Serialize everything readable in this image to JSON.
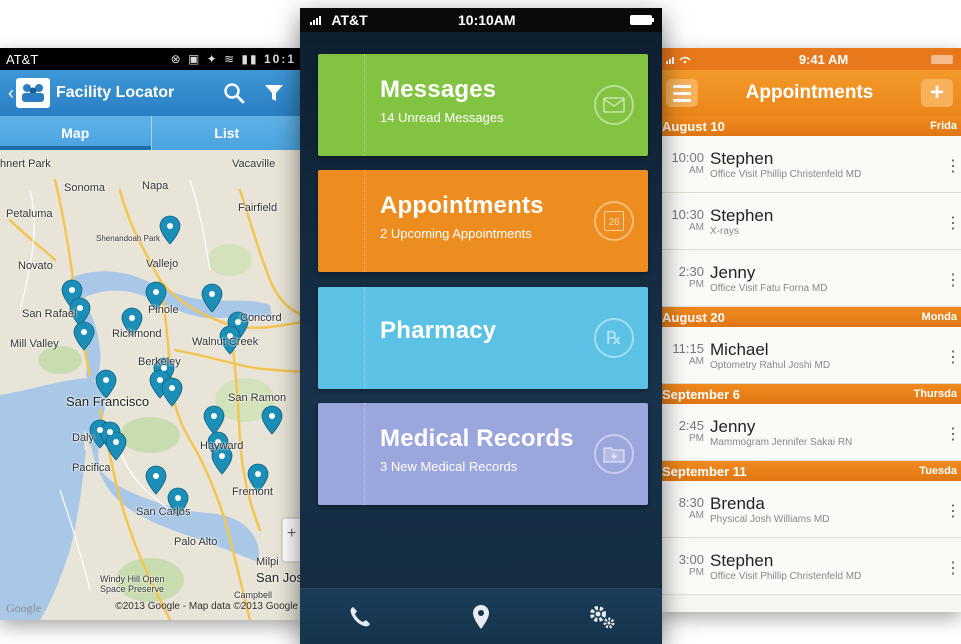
{
  "left_phone": {
    "status": {
      "carrier": "AT&T",
      "time": "10:1"
    },
    "app_bar": {
      "title": "Facility Locator"
    },
    "tabs": [
      {
        "label": "Map",
        "active": true
      },
      {
        "label": "List",
        "active": false
      }
    ],
    "map": {
      "places": [
        "hnert Park",
        "Sonoma",
        "Napa",
        "Vacaville",
        "Petaluma",
        "Fairfield",
        "Shenandoah Park",
        "Novato",
        "Vallejo",
        "San Rafael",
        "Pinole",
        "Concord",
        "Richmond",
        "Walnut Creek",
        "Mill Valley",
        "Berkeley",
        "San Francisco",
        "San Ramon",
        "Daly",
        "Hayward",
        "Pacifica",
        "Fremont",
        "San Carlos",
        "Palo Alto",
        "Milpi",
        "Windy Hill Open Space Preserve",
        "San Jos",
        "Campbell"
      ],
      "copyright": "©2013 Google - Map data ©2013 Google",
      "logo_text": "Google"
    }
  },
  "center_phone": {
    "status": {
      "carrier": "AT&T",
      "time": "10:10AM"
    },
    "tiles": [
      {
        "title": "Messages",
        "subtitle": "14 Unread Messages",
        "icon": "envelope-icon",
        "color": "#82c341"
      },
      {
        "title": "Appointments",
        "subtitle": "2 Upcoming Appointments",
        "icon": "calendar-icon",
        "icon_text": "26",
        "color": "#ee8d1f"
      },
      {
        "title": "Pharmacy",
        "subtitle": "",
        "icon": "rx-icon",
        "color": "#5bc1e5"
      },
      {
        "title": "Medical Records",
        "subtitle": "3 New Medical Records",
        "icon": "folder-icon",
        "color": "#9ba6dc"
      }
    ],
    "tabbar": [
      "phone-icon",
      "location-pin-icon",
      "settings-gears-icon"
    ]
  },
  "right_phone": {
    "status": {
      "time": "9:41 AM"
    },
    "app_bar": {
      "title": "Appointments",
      "add_label": "+"
    },
    "days": [
      {
        "date": "August 10",
        "weekday": "Frida",
        "items": [
          {
            "time": "10:00",
            "ampm": "AM",
            "name": "Stephen",
            "detail": "Office Visit Phillip Christenfeld MD"
          },
          {
            "time": "10:30",
            "ampm": "AM",
            "name": "Stephen",
            "detail": "X-rays"
          },
          {
            "time": "2:30",
            "ampm": "PM",
            "name": "Jenny",
            "detail": "Office Visit Fatu Forna MD"
          }
        ]
      },
      {
        "date": "August 20",
        "weekday": "Monda",
        "items": [
          {
            "time": "11:15",
            "ampm": "AM",
            "name": "Michael",
            "detail": "Optometry Rahul Joshi MD"
          }
        ]
      },
      {
        "date": "September 6",
        "weekday": "Thursda",
        "items": [
          {
            "time": "2:45",
            "ampm": "PM",
            "name": "Jenny",
            "detail": "Mammogram Jennifer Sakai RN"
          }
        ]
      },
      {
        "date": "September 11",
        "weekday": "Tuesda",
        "items": [
          {
            "time": "8:30",
            "ampm": "AM",
            "name": "Brenda",
            "detail": "Physical Josh Williams MD"
          },
          {
            "time": "3:00",
            "ampm": "PM",
            "name": "Stephen",
            "detail": "Office Visit Phillip Christenfeld MD"
          }
        ]
      }
    ]
  },
  "colors": {
    "android_blue": "#2a7fc2",
    "orange": "#ee8d1f",
    "green": "#82c341",
    "sky": "#5bc1e5",
    "lavender": "#9ba6dc",
    "navy": "#15334c",
    "pin": "#1c8fb8"
  }
}
